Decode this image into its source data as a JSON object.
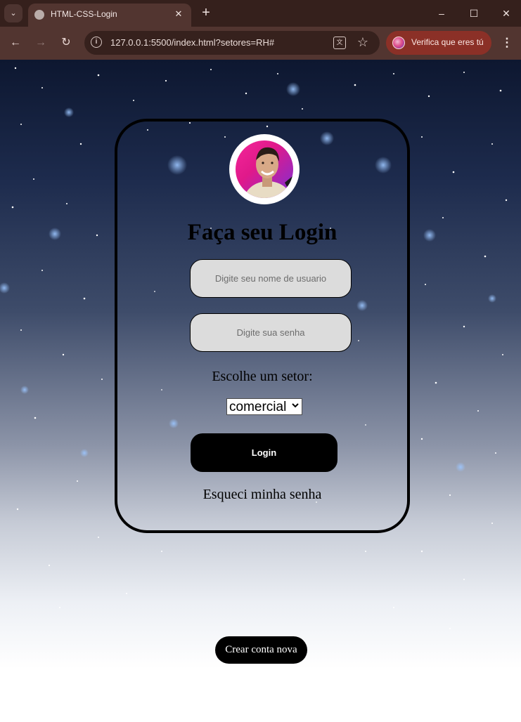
{
  "browser": {
    "tab_title": "HTML-CSS-Login",
    "tab_close": "✕",
    "new_tab": "+",
    "url": "127.0.0.1:5500/index.html?setores=RH#",
    "profile_label": "Verifica que eres tú"
  },
  "login": {
    "heading": "Faça seu Login",
    "username_placeholder": "Digite seu nome de usuario",
    "password_placeholder": "Digite sua senha",
    "sector_label": "Escolhe um setor:",
    "sector_value": "comercial",
    "login_label": "Login",
    "forgot_label": "Esqueci minha senha"
  },
  "footer": {
    "create_account_label": "Crear conta nova"
  },
  "colors": {
    "card_border": "#000000",
    "input_bg": "#dcdcdc",
    "button_bg": "#000000",
    "button_text": "#ffffff",
    "chrome_bg": "#523530",
    "profile_chip": "#8b3027"
  },
  "icons": [
    "tab-search-icon",
    "globe-icon",
    "close-icon",
    "plus-icon",
    "minimize-icon",
    "maximize-icon",
    "back-icon",
    "forward-icon",
    "reload-icon",
    "info-icon",
    "translate-icon",
    "star-icon",
    "profile-avatar-icon",
    "kebab-menu-icon",
    "chevron-down-icon"
  ]
}
